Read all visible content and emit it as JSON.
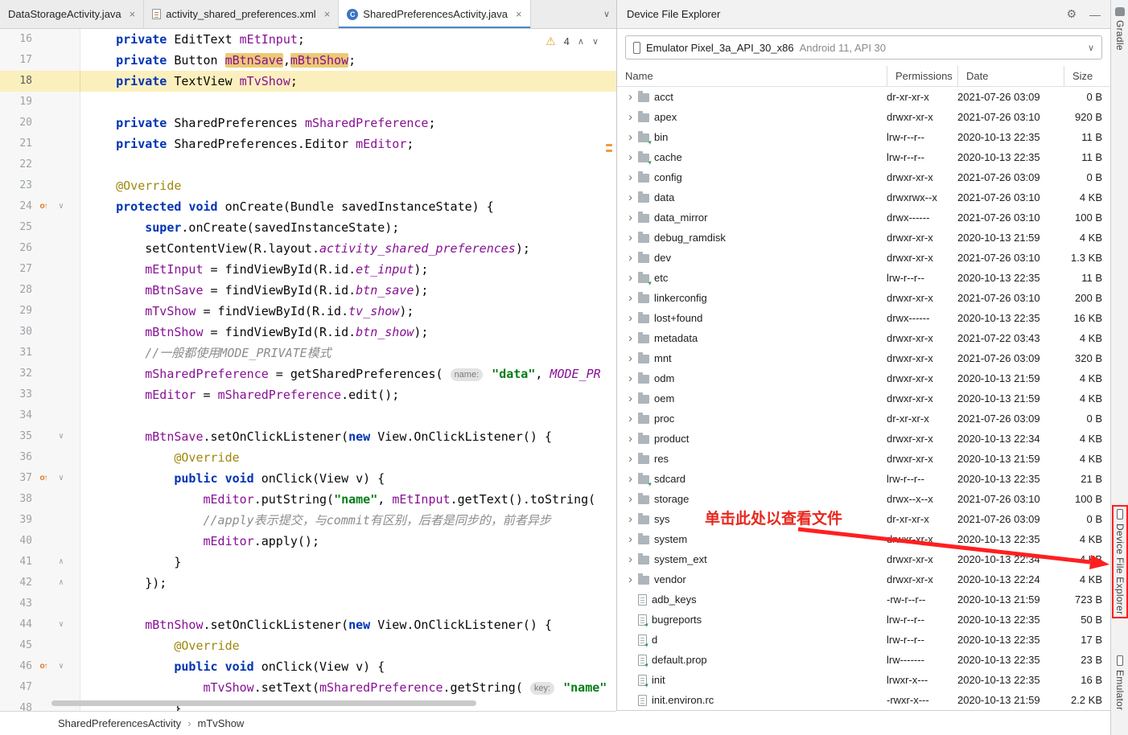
{
  "icons": {
    "gear": "⚙",
    "minimize": "—",
    "chevron_down": "∨",
    "chevron_up": "∧",
    "warning": "⚠",
    "close": "×",
    "dir_chevron": "›",
    "fold_open": "∨",
    "fold_close": "∧",
    "override": "o↑",
    "breadcrumb_sep": "›"
  },
  "colors": {
    "keyword": "#0033b3",
    "field": "#871094",
    "string": "#067d17",
    "comment": "#8c8c8c",
    "annotation_member": "#9e880d",
    "current_line": "#fbf0bd",
    "occurrence_highlight": "#ecca74",
    "red_annotation": "#e8281e",
    "tab_underline": "#4a88c7"
  },
  "tabs": [
    {
      "label": "DataStorageActivity.java",
      "icon": null,
      "letter": null,
      "selected": false
    },
    {
      "label": "activity_shared_preferences.xml",
      "icon": "xml-file",
      "letter": null,
      "selected": false
    },
    {
      "label": "SharedPreferencesActivity.java",
      "icon": "java-class",
      "letter": "C",
      "selected": true
    }
  ],
  "editor": {
    "warning_count": "4",
    "lines": [
      {
        "n": "16",
        "s": [
          [
            "    ",
            "p"
          ],
          [
            "private ",
            "k"
          ],
          [
            "EditText ",
            "p"
          ],
          [
            "mEtInput",
            "f"
          ],
          [
            ";",
            "p"
          ]
        ]
      },
      {
        "n": "17",
        "s": [
          [
            "    ",
            "p"
          ],
          [
            "private ",
            "k"
          ],
          [
            "Button ",
            "p"
          ],
          [
            "mBtnSave",
            "hl"
          ],
          [
            ",",
            "p"
          ],
          [
            "mBtnShow",
            "hl"
          ],
          [
            ";",
            "p"
          ]
        ]
      },
      {
        "n": "18",
        "cur": true,
        "s": [
          [
            "    ",
            "p"
          ],
          [
            "private ",
            "k"
          ],
          [
            "TextView ",
            "p"
          ],
          [
            "mTvShow",
            "f"
          ],
          [
            ";",
            "p"
          ]
        ]
      },
      {
        "n": "19",
        "s": []
      },
      {
        "n": "20",
        "s": [
          [
            "    ",
            "p"
          ],
          [
            "private ",
            "k"
          ],
          [
            "SharedPreferences ",
            "p"
          ],
          [
            "mSharedPreference",
            "f"
          ],
          [
            ";",
            "p"
          ]
        ]
      },
      {
        "n": "21",
        "s": [
          [
            "    ",
            "p"
          ],
          [
            "private ",
            "k"
          ],
          [
            "SharedPreferences.Editor ",
            "p"
          ],
          [
            "mEditor",
            "f"
          ],
          [
            ";",
            "p"
          ]
        ]
      },
      {
        "n": "22",
        "s": []
      },
      {
        "n": "23",
        "s": [
          [
            "    ",
            "p"
          ],
          [
            "@Override",
            "a"
          ]
        ]
      },
      {
        "n": "24",
        "ovr": true,
        "fold": "open",
        "s": [
          [
            "    ",
            "p"
          ],
          [
            "protected ",
            "k"
          ],
          [
            "void ",
            "k"
          ],
          [
            "onCreate(Bundle savedInstanceState) {",
            "p"
          ]
        ]
      },
      {
        "n": "25",
        "s": [
          [
            "        ",
            "p"
          ],
          [
            "super",
            "k"
          ],
          [
            ".onCreate(savedInstanceState);",
            "p"
          ]
        ]
      },
      {
        "n": "26",
        "s": [
          [
            "        ",
            "p"
          ],
          [
            "setContentView(R.layout.",
            "p"
          ],
          [
            "activity_shared_preferences",
            "st"
          ],
          [
            ");",
            "p"
          ]
        ]
      },
      {
        "n": "27",
        "s": [
          [
            "        ",
            "p"
          ],
          [
            "mEtInput",
            "f"
          ],
          [
            " = findViewById(R.id.",
            "p"
          ],
          [
            "et_input",
            "st"
          ],
          [
            ");",
            "p"
          ]
        ]
      },
      {
        "n": "28",
        "s": [
          [
            "        ",
            "p"
          ],
          [
            "mBtnSave",
            "f"
          ],
          [
            " = findViewById(R.id.",
            "p"
          ],
          [
            "btn_save",
            "st"
          ],
          [
            ");",
            "p"
          ]
        ]
      },
      {
        "n": "29",
        "s": [
          [
            "        ",
            "p"
          ],
          [
            "mTvShow",
            "f"
          ],
          [
            " = findViewById(R.id.",
            "p"
          ],
          [
            "tv_show",
            "st"
          ],
          [
            ");",
            "p"
          ]
        ]
      },
      {
        "n": "30",
        "s": [
          [
            "        ",
            "p"
          ],
          [
            "mBtnShow",
            "f"
          ],
          [
            " = findViewById(R.id.",
            "p"
          ],
          [
            "btn_show",
            "st"
          ],
          [
            ");",
            "p"
          ]
        ]
      },
      {
        "n": "31",
        "s": [
          [
            "        ",
            "p"
          ],
          [
            "//一般都使用MODE_PRIVATE模式",
            "c"
          ]
        ]
      },
      {
        "n": "32",
        "s": [
          [
            "        ",
            "p"
          ],
          [
            "mSharedPreference",
            "f"
          ],
          [
            " = getSharedPreferences( ",
            "p"
          ],
          [
            "name:",
            "h"
          ],
          [
            " ",
            "p"
          ],
          [
            "\"data\"",
            "s"
          ],
          [
            ", ",
            "p"
          ],
          [
            "MODE_PR",
            "st"
          ]
        ]
      },
      {
        "n": "33",
        "s": [
          [
            "        ",
            "p"
          ],
          [
            "mEditor",
            "f"
          ],
          [
            " = ",
            "p"
          ],
          [
            "mSharedPreference",
            "f"
          ],
          [
            ".edit();",
            "p"
          ]
        ]
      },
      {
        "n": "34",
        "s": []
      },
      {
        "n": "35",
        "fold": "open",
        "s": [
          [
            "        ",
            "p"
          ],
          [
            "mBtnSave",
            "f"
          ],
          [
            ".setOnClickListener(",
            "p"
          ],
          [
            "new ",
            "k"
          ],
          [
            "View.OnClickListener() {",
            "p"
          ]
        ]
      },
      {
        "n": "36",
        "s": [
          [
            "            ",
            "p"
          ],
          [
            "@Override",
            "a"
          ]
        ]
      },
      {
        "n": "37",
        "ovr": true,
        "fold": "open",
        "s": [
          [
            "            ",
            "p"
          ],
          [
            "public ",
            "k"
          ],
          [
            "void ",
            "k"
          ],
          [
            "onClick(View v) {",
            "p"
          ]
        ]
      },
      {
        "n": "38",
        "s": [
          [
            "                ",
            "p"
          ],
          [
            "mEditor",
            "f"
          ],
          [
            ".putString(",
            "p"
          ],
          [
            "\"name\"",
            "s"
          ],
          [
            ", ",
            "p"
          ],
          [
            "mEtInput",
            "f"
          ],
          [
            ".getText().toString(",
            "p"
          ]
        ]
      },
      {
        "n": "39",
        "s": [
          [
            "                ",
            "p"
          ],
          [
            "//apply表示提交，与commit有区别，后者是同步的，前者异步",
            "c"
          ]
        ]
      },
      {
        "n": "40",
        "s": [
          [
            "                ",
            "p"
          ],
          [
            "mEditor",
            "f"
          ],
          [
            ".apply();",
            "p"
          ]
        ]
      },
      {
        "n": "41",
        "fold": "close",
        "s": [
          [
            "            ",
            "p"
          ],
          [
            "}",
            "p"
          ]
        ]
      },
      {
        "n": "42",
        "fold": "close",
        "s": [
          [
            "        ",
            "p"
          ],
          [
            "});",
            "p"
          ]
        ]
      },
      {
        "n": "43",
        "s": []
      },
      {
        "n": "44",
        "fold": "open",
        "s": [
          [
            "        ",
            "p"
          ],
          [
            "mBtnShow",
            "f"
          ],
          [
            ".setOnClickListener(",
            "p"
          ],
          [
            "new ",
            "k"
          ],
          [
            "View.OnClickListener() {",
            "p"
          ]
        ]
      },
      {
        "n": "45",
        "s": [
          [
            "            ",
            "p"
          ],
          [
            "@Override",
            "a"
          ]
        ]
      },
      {
        "n": "46",
        "ovr": true,
        "fold": "open",
        "s": [
          [
            "            ",
            "p"
          ],
          [
            "public ",
            "k"
          ],
          [
            "void ",
            "k"
          ],
          [
            "onClick(View v) {",
            "p"
          ]
        ]
      },
      {
        "n": "47",
        "s": [
          [
            "                ",
            "p"
          ],
          [
            "mTvShow",
            "f"
          ],
          [
            ".setText(",
            "p"
          ],
          [
            "mSharedPreference",
            "f"
          ],
          [
            ".getString( ",
            "p"
          ],
          [
            "key:",
            "h"
          ],
          [
            " ",
            "p"
          ],
          [
            "\"name\"",
            "s"
          ]
        ]
      },
      {
        "n": "48",
        "s": [
          [
            "            ",
            "p"
          ],
          [
            "}",
            "p"
          ]
        ]
      }
    ]
  },
  "breadcrumb": {
    "items": [
      "SharedPreferencesActivity",
      "mTvShow"
    ]
  },
  "explorer": {
    "title": "Device File Explorer",
    "device_main": "Emulator Pixel_3a_API_30_x86",
    "device_sub": "Android 11, API 30",
    "columns": [
      "Name",
      "Permissions",
      "Date",
      "Size"
    ],
    "rows": [
      {
        "name": "acct",
        "type": "dir",
        "perm": "dr-xr-xr-x",
        "date": "2021-07-26 03:09",
        "size": "0 B"
      },
      {
        "name": "apex",
        "type": "dir",
        "perm": "drwxr-xr-x",
        "date": "2021-07-26 03:10",
        "size": "920 B"
      },
      {
        "name": "bin",
        "type": "dir",
        "perm": "lrw-r--r--",
        "date": "2020-10-13 22:35",
        "size": "11 B"
      },
      {
        "name": "cache",
        "type": "dir",
        "perm": "lrw-r--r--",
        "date": "2020-10-13 22:35",
        "size": "11 B"
      },
      {
        "name": "config",
        "type": "dir",
        "perm": "drwxr-xr-x",
        "date": "2021-07-26 03:09",
        "size": "0 B"
      },
      {
        "name": "data",
        "type": "dir",
        "perm": "drwxrwx--x",
        "date": "2021-07-26 03:10",
        "size": "4 KB"
      },
      {
        "name": "data_mirror",
        "type": "dir",
        "perm": "drwx------",
        "date": "2021-07-26 03:10",
        "size": "100 B"
      },
      {
        "name": "debug_ramdisk",
        "type": "dir",
        "perm": "drwxr-xr-x",
        "date": "2020-10-13 21:59",
        "size": "4 KB"
      },
      {
        "name": "dev",
        "type": "dir",
        "perm": "drwxr-xr-x",
        "date": "2021-07-26 03:10",
        "size": "1.3 KB"
      },
      {
        "name": "etc",
        "type": "dir",
        "perm": "lrw-r--r--",
        "date": "2020-10-13 22:35",
        "size": "11 B"
      },
      {
        "name": "linkerconfig",
        "type": "dir",
        "perm": "drwxr-xr-x",
        "date": "2021-07-26 03:10",
        "size": "200 B"
      },
      {
        "name": "lost+found",
        "type": "dir",
        "perm": "drwx------",
        "date": "2020-10-13 22:35",
        "size": "16 KB"
      },
      {
        "name": "metadata",
        "type": "dir",
        "perm": "drwxr-xr-x",
        "date": "2021-07-22 03:43",
        "size": "4 KB"
      },
      {
        "name": "mnt",
        "type": "dir",
        "perm": "drwxr-xr-x",
        "date": "2021-07-26 03:09",
        "size": "320 B"
      },
      {
        "name": "odm",
        "type": "dir",
        "perm": "drwxr-xr-x",
        "date": "2020-10-13 21:59",
        "size": "4 KB"
      },
      {
        "name": "oem",
        "type": "dir",
        "perm": "drwxr-xr-x",
        "date": "2020-10-13 21:59",
        "size": "4 KB"
      },
      {
        "name": "proc",
        "type": "dir",
        "perm": "dr-xr-xr-x",
        "date": "2021-07-26 03:09",
        "size": "0 B"
      },
      {
        "name": "product",
        "type": "dir",
        "perm": "drwxr-xr-x",
        "date": "2020-10-13 22:34",
        "size": "4 KB"
      },
      {
        "name": "res",
        "type": "dir",
        "perm": "drwxr-xr-x",
        "date": "2020-10-13 21:59",
        "size": "4 KB"
      },
      {
        "name": "sdcard",
        "type": "dir",
        "perm": "lrw-r--r--",
        "date": "2020-10-13 22:35",
        "size": "21 B"
      },
      {
        "name": "storage",
        "type": "dir",
        "perm": "drwx--x--x",
        "date": "2021-07-26 03:10",
        "size": "100 B"
      },
      {
        "name": "sys",
        "type": "dir",
        "perm": "dr-xr-xr-x",
        "date": "2021-07-26 03:09",
        "size": "0 B"
      },
      {
        "name": "system",
        "type": "dir",
        "perm": "drwxr-xr-x",
        "date": "2020-10-13 22:35",
        "size": "4 KB"
      },
      {
        "name": "system_ext",
        "type": "dir",
        "perm": "drwxr-xr-x",
        "date": "2020-10-13 22:34",
        "size": "4 KB"
      },
      {
        "name": "vendor",
        "type": "dir",
        "perm": "drwxr-xr-x",
        "date": "2020-10-13 22:24",
        "size": "4 KB"
      },
      {
        "name": "adb_keys",
        "type": "file",
        "perm": "-rw-r--r--",
        "date": "2020-10-13 21:59",
        "size": "723 B"
      },
      {
        "name": "bugreports",
        "type": "file",
        "perm": "lrw-r--r--",
        "date": "2020-10-13 22:35",
        "size": "50 B"
      },
      {
        "name": "d",
        "type": "file",
        "perm": "lrw-r--r--",
        "date": "2020-10-13 22:35",
        "size": "17 B"
      },
      {
        "name": "default.prop",
        "type": "file",
        "perm": "lrw-------",
        "date": "2020-10-13 22:35",
        "size": "23 B"
      },
      {
        "name": "init",
        "type": "file",
        "perm": "lrwxr-x---",
        "date": "2020-10-13 22:35",
        "size": "16 B"
      },
      {
        "name": "init.environ.rc",
        "type": "file",
        "perm": "-rwxr-x---",
        "date": "2020-10-13 21:59",
        "size": "2.2 KB"
      }
    ]
  },
  "stripe": {
    "items": [
      {
        "label": "Gradle",
        "icon": "gradle",
        "highlighted": false
      },
      {
        "label": "Device File Explorer",
        "icon": "phone",
        "highlighted": true
      },
      {
        "label": "Emulator",
        "icon": "phone",
        "highlighted": false
      }
    ]
  },
  "annotation": {
    "text": "单击此处以查看文件"
  }
}
